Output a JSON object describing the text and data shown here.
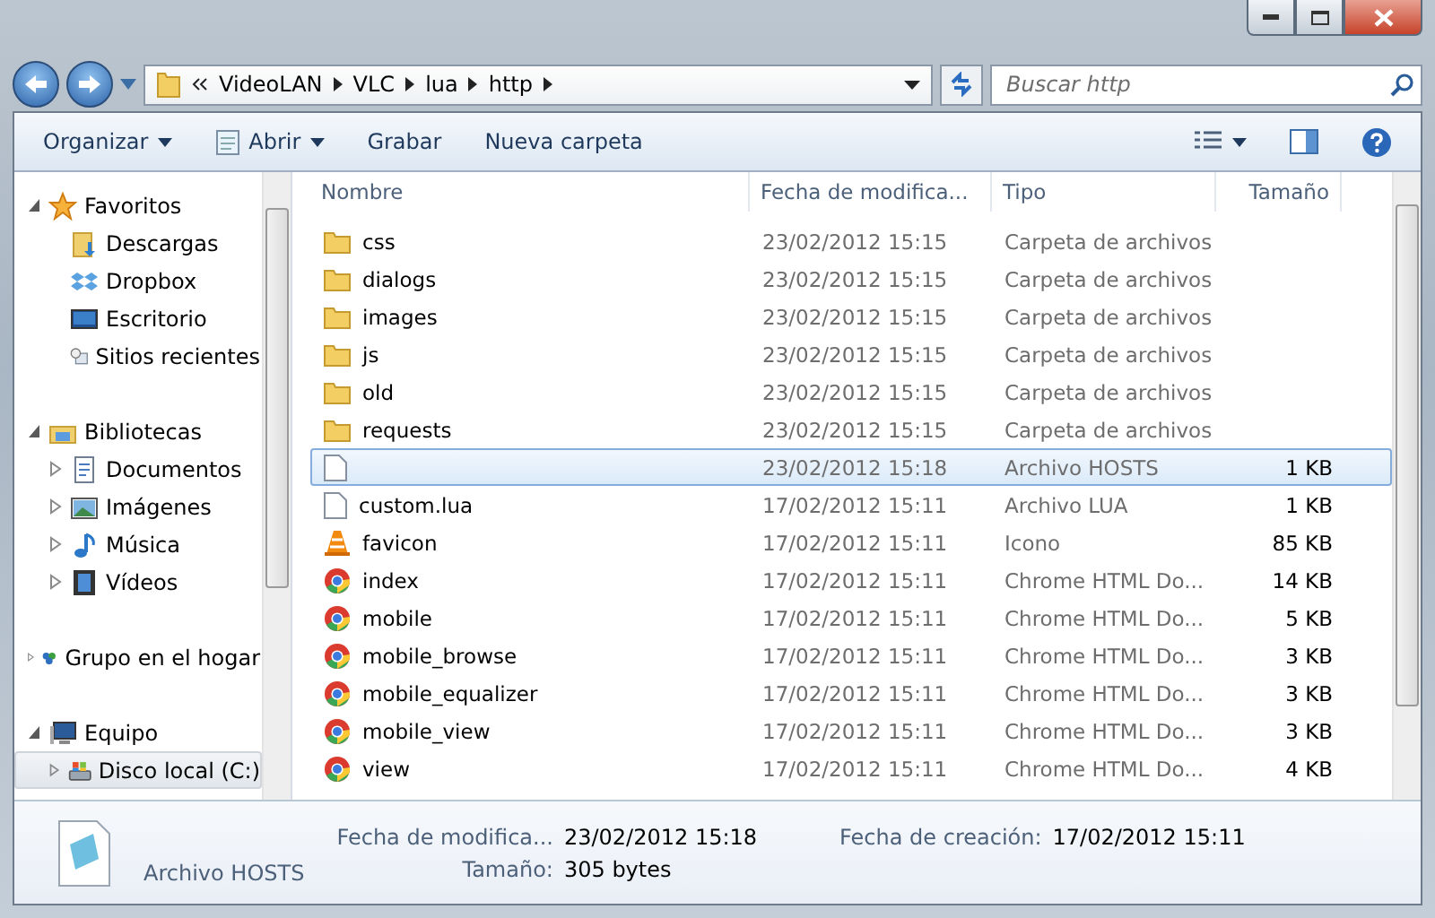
{
  "address": {
    "path": [
      "VideoLAN",
      "VLC",
      "lua",
      "http"
    ],
    "search_placeholder": "Buscar http"
  },
  "toolbar": [
    {
      "label": "Organizar",
      "kind": "menu"
    },
    {
      "label": "Abrir",
      "kind": "open"
    },
    {
      "label": "Grabar",
      "kind": "plain"
    },
    {
      "label": "Nueva carpeta",
      "kind": "plain"
    }
  ],
  "nav": [
    {
      "label": "Favoritos",
      "expanded": true,
      "selected": false,
      "children": [
        {
          "label": "Descargas",
          "selected": false
        },
        {
          "label": "Dropbox",
          "selected": false
        },
        {
          "label": "Escritorio",
          "selected": false
        },
        {
          "label": "Sitios recientes",
          "selected": false
        }
      ]
    },
    {
      "label": "Bibliotecas",
      "expanded": true,
      "selected": false,
      "children": [
        {
          "label": "Documentos",
          "expanded": false,
          "selected": false
        },
        {
          "label": "Imágenes",
          "expanded": false,
          "selected": false
        },
        {
          "label": "Música",
          "expanded": false,
          "selected": false
        },
        {
          "label": "Vídeos",
          "expanded": false,
          "selected": false
        }
      ]
    },
    {
      "label": "Grupo en el hogar",
      "expanded": false,
      "selected": false
    },
    {
      "label": "Equipo",
      "expanded": true,
      "selected": false,
      "children": [
        {
          "label": "Disco local (C:)",
          "expanded": false,
          "selected": true
        }
      ]
    }
  ],
  "columns": [
    "Nombre",
    "Fecha de modifica...",
    "Tipo",
    "Tamaño"
  ],
  "rows": [
    {
      "name": "css",
      "date": "23/02/2012 15:15",
      "type": "Carpeta de archivos",
      "kind": "folder",
      "selected": false
    },
    {
      "name": "dialogs",
      "date": "23/02/2012 15:15",
      "type": "Carpeta de archivos",
      "kind": "folder",
      "selected": false
    },
    {
      "name": "images",
      "date": "23/02/2012 15:15",
      "type": "Carpeta de archivos",
      "kind": "folder",
      "selected": false
    },
    {
      "name": "js",
      "date": "23/02/2012 15:15",
      "type": "Carpeta de archivos",
      "kind": "folder",
      "selected": false
    },
    {
      "name": "old",
      "date": "23/02/2012 15:15",
      "type": "Carpeta de archivos",
      "kind": "folder",
      "selected": false
    },
    {
      "name": "requests",
      "date": "23/02/2012 15:15",
      "type": "Carpeta de archivos",
      "kind": "folder",
      "selected": false
    },
    {
      "date": "23/02/2012 15:18",
      "type": "Archivo HOSTS",
      "size": "1 KB",
      "kind": "file",
      "selected": true
    },
    {
      "name": "custom.lua",
      "date": "17/02/2012 15:11",
      "type": "Archivo LUA",
      "size": "1 KB",
      "kind": "file",
      "selected": false
    },
    {
      "name": "favicon",
      "date": "17/02/2012 15:11",
      "type": "Icono",
      "size": "85 KB",
      "kind": "cone",
      "selected": false
    },
    {
      "name": "index",
      "date": "17/02/2012 15:11",
      "type": "Chrome HTML Do...",
      "size": "14 KB",
      "kind": "chrome",
      "selected": false
    },
    {
      "name": "mobile",
      "date": "17/02/2012 15:11",
      "type": "Chrome HTML Do...",
      "size": "5 KB",
      "kind": "chrome",
      "selected": false
    },
    {
      "name": "mobile_browse",
      "date": "17/02/2012 15:11",
      "type": "Chrome HTML Do...",
      "size": "3 KB",
      "kind": "chrome",
      "selected": false
    },
    {
      "name": "mobile_equalizer",
      "date": "17/02/2012 15:11",
      "type": "Chrome HTML Do...",
      "size": "3 KB",
      "kind": "chrome",
      "selected": false
    },
    {
      "name": "mobile_view",
      "date": "17/02/2012 15:11",
      "type": "Chrome HTML Do...",
      "size": "3 KB",
      "kind": "chrome",
      "selected": false
    },
    {
      "name": "view",
      "date": "17/02/2012 15:11",
      "type": "Chrome HTML Do...",
      "size": "4 KB",
      "kind": "chrome",
      "selected": false
    }
  ],
  "details": {
    "type": "Archivo HOSTS",
    "fields": [
      {
        "label": "Fecha de modifica...",
        "value": "23/02/2012 15:18"
      },
      {
        "label": "Tamaño:",
        "value": "305 bytes"
      },
      {
        "label": "Fecha de creación:",
        "value": "17/02/2012 15:11"
      }
    ]
  }
}
